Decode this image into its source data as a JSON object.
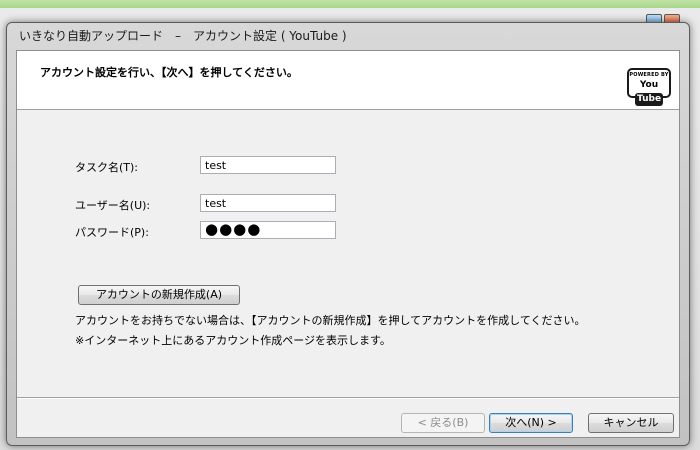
{
  "window": {
    "title": "いきなり自動アップロード　–　アカウント設定 ( YouTube )"
  },
  "header": {
    "instruction": "アカウント設定を行い、【次へ】を押してください。",
    "badge": {
      "powered_by": "POWERED BY",
      "logo_you": "You",
      "logo_tube": "Tube"
    }
  },
  "form": {
    "task_name": {
      "label": "タスク名(T):",
      "value": "test"
    },
    "user_name": {
      "label": "ユーザー名(U):",
      "value": "test"
    },
    "password": {
      "label": "パスワード(P):",
      "masked_value": "●●●●"
    }
  },
  "create_account": {
    "button_label": "アカウントの新規作成(A)",
    "note_1": "アカウントをお持ちでない場合は、【アカウントの新規作成】を押してアカウントを作成してください。",
    "note_2": "※インターネット上にあるアカウント作成ページを表示します。"
  },
  "footer": {
    "back_label": "< 戻る(B)",
    "next_label": "次へ(N) >",
    "cancel_label": "キャンセル"
  },
  "colors": {
    "desktop_green": "#7fbd55",
    "dialog_bg": "#f0f0f0",
    "default_button_border": "#3c7fb1"
  }
}
